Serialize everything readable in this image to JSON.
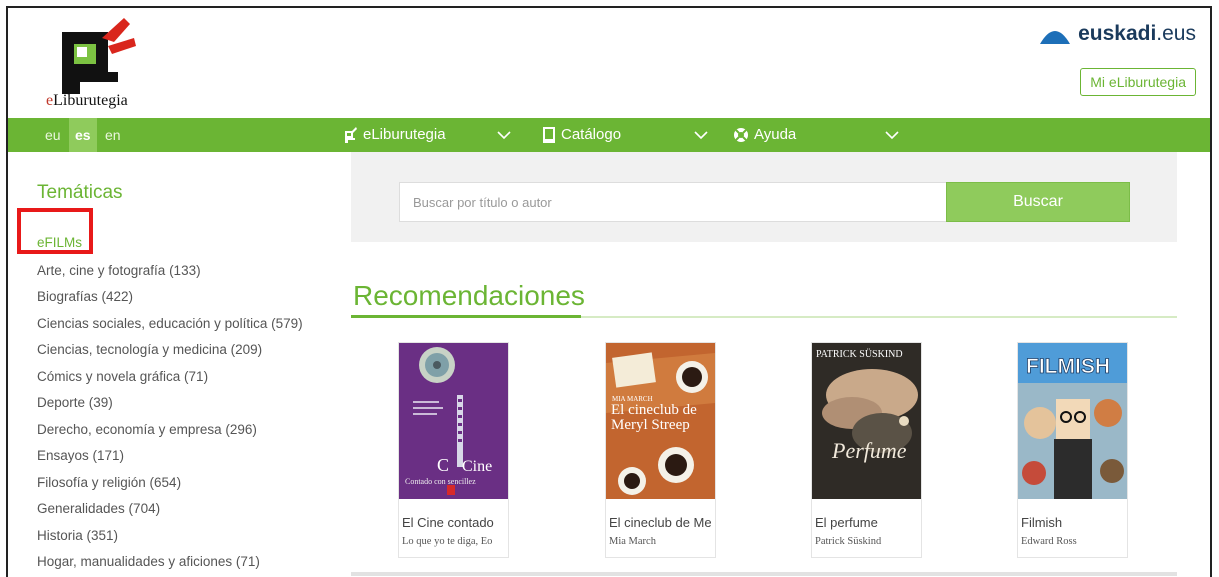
{
  "header": {
    "logo_text_e": "e",
    "logo_text_rest": "Liburutegia",
    "euskadi_bold": "euskadi",
    "euskadi_tld": ".eus",
    "mi_button": "Mi eLiburutegia"
  },
  "nav": {
    "languages": [
      "eu",
      "es",
      "en"
    ],
    "active_language": "es",
    "menus": [
      "eLiburutegia",
      "Catálogo",
      "Ayuda"
    ]
  },
  "sidebar": {
    "title": "Temáticas",
    "categories": [
      "eFILMs",
      "Arte, cine y fotografía (133)",
      "Biografías (422)",
      "Ciencias sociales, educación y política (579)",
      "Ciencias, tecnología y medicina (209)",
      "Cómics y novela gráfica (71)",
      "Deporte (39)",
      "Derecho, economía y empresa (296)",
      "Ensayos (171)",
      "Filosofía y religión (654)",
      "Generalidades (704)",
      "Historia (351)",
      "Hogar, manualidades y aficiones (71)"
    ]
  },
  "search": {
    "placeholder": "Buscar por título o autor",
    "button": "Buscar"
  },
  "recommendations": {
    "title": "Recomendaciones",
    "books": [
      {
        "title": "El Cine contado",
        "author": "Lo que yo te diga, Eo",
        "cover_top": "",
        "cover_main": "Cine",
        "cover_sub": "Contado con sencillez"
      },
      {
        "title": "El cineclub de Me",
        "author": "Mia March",
        "cover_top": "MIA MARCH",
        "cover_main": "El cineclub de Meryl Streep",
        "cover_sub": ""
      },
      {
        "title": "El perfume",
        "author": "Patrick Süskind",
        "cover_top": "PATRICK SÜSKIND",
        "cover_main": "Perfume",
        "cover_sub": ""
      },
      {
        "title": "Filmish",
        "author": "Edward Ross",
        "cover_top": "",
        "cover_main": "FILMISH",
        "cover_sub": ""
      }
    ]
  },
  "colors": {
    "accent": "#6bb534",
    "accent_light": "#8fcb5c",
    "highlight": "#e81919",
    "euskadi": "#1a3a5c"
  }
}
